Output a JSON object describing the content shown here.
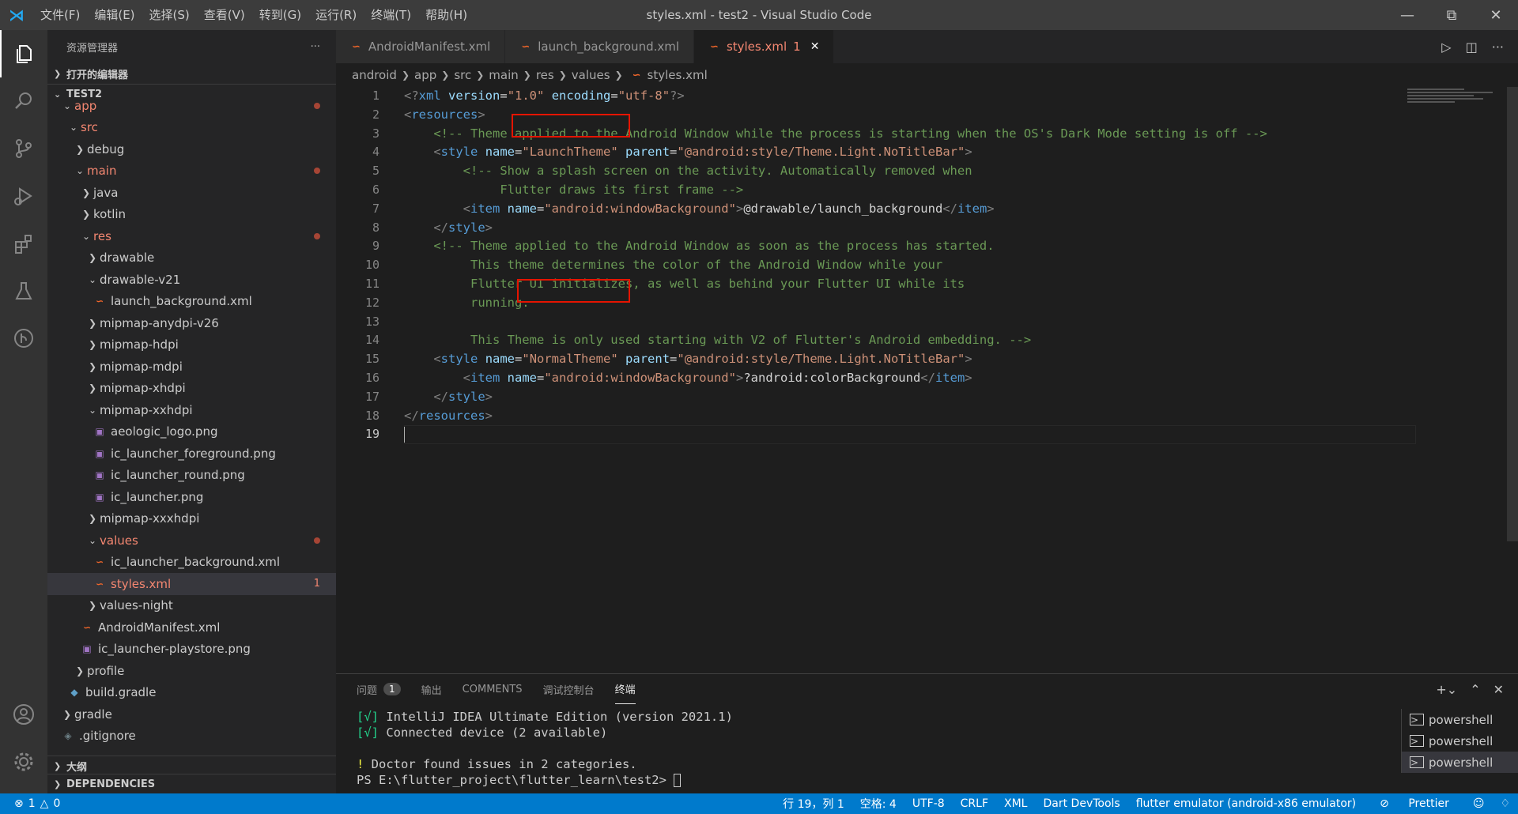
{
  "titlebar": {
    "title": "styles.xml - test2 - Visual Studio Code",
    "menu": [
      "文件(F)",
      "编辑(E)",
      "选择(S)",
      "查看(V)",
      "转到(G)",
      "运行(R)",
      "终端(T)",
      "帮助(H)"
    ]
  },
  "sidebar": {
    "header": "资源管理器",
    "more": "···",
    "open_editors": "打开的编辑器",
    "project": "TEST2",
    "outline": "大纲",
    "dependencies": "DEPENDENCIES",
    "tree": [
      {
        "label": "app",
        "indent": 1,
        "chev": "⌄",
        "kind": "folder",
        "color": "red",
        "dot": true
      },
      {
        "label": "src",
        "indent": 2,
        "chev": "⌄",
        "kind": "folder",
        "color": "red"
      },
      {
        "label": "debug",
        "indent": 3,
        "chev": "›",
        "kind": "folder"
      },
      {
        "label": "main",
        "indent": 3,
        "chev": "⌄",
        "kind": "folder",
        "color": "red",
        "dot": true
      },
      {
        "label": "java",
        "indent": 4,
        "chev": "›",
        "kind": "folder"
      },
      {
        "label": "kotlin",
        "indent": 4,
        "chev": "›",
        "kind": "folder"
      },
      {
        "label": "res",
        "indent": 4,
        "chev": "⌄",
        "kind": "folder",
        "color": "red",
        "dot": true
      },
      {
        "label": "drawable",
        "indent": 5,
        "chev": "›",
        "kind": "folder"
      },
      {
        "label": "drawable-v21",
        "indent": 5,
        "chev": "⌄",
        "kind": "folder"
      },
      {
        "label": "launch_background.xml",
        "indent": 6,
        "kind": "xml"
      },
      {
        "label": "mipmap-anydpi-v26",
        "indent": 5,
        "chev": "›",
        "kind": "folder"
      },
      {
        "label": "mipmap-hdpi",
        "indent": 5,
        "chev": "›",
        "kind": "folder"
      },
      {
        "label": "mipmap-mdpi",
        "indent": 5,
        "chev": "›",
        "kind": "folder"
      },
      {
        "label": "mipmap-xhdpi",
        "indent": 5,
        "chev": "›",
        "kind": "folder"
      },
      {
        "label": "mipmap-xxhdpi",
        "indent": 5,
        "chev": "⌄",
        "kind": "folder"
      },
      {
        "label": "aeologic_logo.png",
        "indent": 6,
        "kind": "png"
      },
      {
        "label": "ic_launcher_foreground.png",
        "indent": 6,
        "kind": "png"
      },
      {
        "label": "ic_launcher_round.png",
        "indent": 6,
        "kind": "png"
      },
      {
        "label": "ic_launcher.png",
        "indent": 6,
        "kind": "png"
      },
      {
        "label": "mipmap-xxxhdpi",
        "indent": 5,
        "chev": "›",
        "kind": "folder"
      },
      {
        "label": "values",
        "indent": 5,
        "chev": "⌄",
        "kind": "folder",
        "color": "red",
        "dot": true
      },
      {
        "label": "ic_launcher_background.xml",
        "indent": 6,
        "kind": "xml"
      },
      {
        "label": "styles.xml",
        "indent": 6,
        "kind": "xml",
        "color": "red",
        "count": "1",
        "selected": true
      },
      {
        "label": "values-night",
        "indent": 5,
        "chev": "›",
        "kind": "folder"
      },
      {
        "label": "AndroidManifest.xml",
        "indent": 4,
        "kind": "xml"
      },
      {
        "label": "ic_launcher-playstore.png",
        "indent": 4,
        "kind": "png"
      },
      {
        "label": "profile",
        "indent": 3,
        "chev": "›",
        "kind": "folder"
      },
      {
        "label": "build.gradle",
        "indent": 2,
        "kind": "gradle"
      },
      {
        "label": "gradle",
        "indent": 1,
        "chev": "›",
        "kind": "folder"
      },
      {
        "label": ".gitignore",
        "indent": 1,
        "kind": "git"
      }
    ]
  },
  "tabs": [
    {
      "label": "AndroidManifest.xml",
      "active": false
    },
    {
      "label": "launch_background.xml",
      "active": false
    },
    {
      "label": "styles.xml",
      "active": true,
      "problems": "1"
    }
  ],
  "breadcrumb": [
    "android",
    "app",
    "src",
    "main",
    "res",
    "values",
    "styles.xml"
  ],
  "editor": {
    "line_numbers": [
      "1",
      "2",
      "3",
      "4",
      "5",
      "6",
      "7",
      "8",
      "9",
      "10",
      "11",
      "12",
      "13",
      "14",
      "15",
      "16",
      "17",
      "18",
      "19"
    ],
    "current_line": "19"
  },
  "panel": {
    "tabs": [
      "问题",
      "输出",
      "COMMENTS",
      "调试控制台",
      "终端"
    ],
    "problems_badge": "1",
    "active_tab": "终端",
    "terminal_lines": [
      {
        "prefix": "[√]",
        "text": " IntelliJ IDEA Ultimate Edition (version 2021.1)"
      },
      {
        "prefix": "[√]",
        "text": " Connected device (2 available)"
      },
      {
        "prefix": "",
        "text": ""
      },
      {
        "prefix": "!",
        "text": " Doctor found issues in 2 categories."
      }
    ],
    "prompt": "PS E:\\flutter_project\\flutter_learn\\test2> ",
    "terminals": [
      "powershell",
      "powershell",
      "powershell"
    ]
  },
  "statusbar": {
    "errors": "1",
    "warnings": "0",
    "position": "行 19，列 1",
    "spaces": "空格: 4",
    "encoding": "UTF-8",
    "eol": "CRLF",
    "language": "XML",
    "devtools": "Dart DevTools",
    "device": "flutter emulator (android-x86 emulator)",
    "prettier": "Prettier"
  },
  "colors": {
    "accent": "#007acc",
    "highlight_box": "#e51400",
    "modified_red": "#f48771"
  }
}
